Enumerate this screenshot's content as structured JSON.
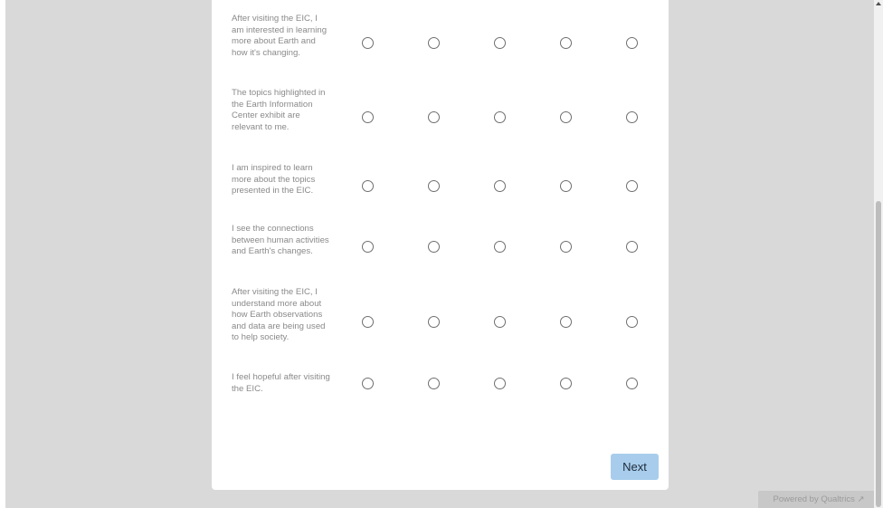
{
  "survey": {
    "rows": [
      {
        "label": "After visiting the EIC, I am interested in learning more about Earth and how it's changing."
      },
      {
        "label": "The topics highlighted in the Earth Information Center exhibit are relevant to me."
      },
      {
        "label": "I am inspired to learn more about the topics presented in the EIC."
      },
      {
        "label": "I see the connections between human activities and Earth's changes."
      },
      {
        "label": "After visiting the EIC, I understand more about how Earth observations and data are being used to help society."
      },
      {
        "label": "I feel hopeful after visiting the EIC."
      }
    ],
    "next_label": "Next"
  },
  "footer": {
    "powered_by": "Powered by Qualtrics ↗"
  },
  "colors": {
    "background": "#d9d9d9",
    "card": "#ffffff",
    "next_button": "#a8cdec",
    "label_text": "#8a8a8a"
  }
}
